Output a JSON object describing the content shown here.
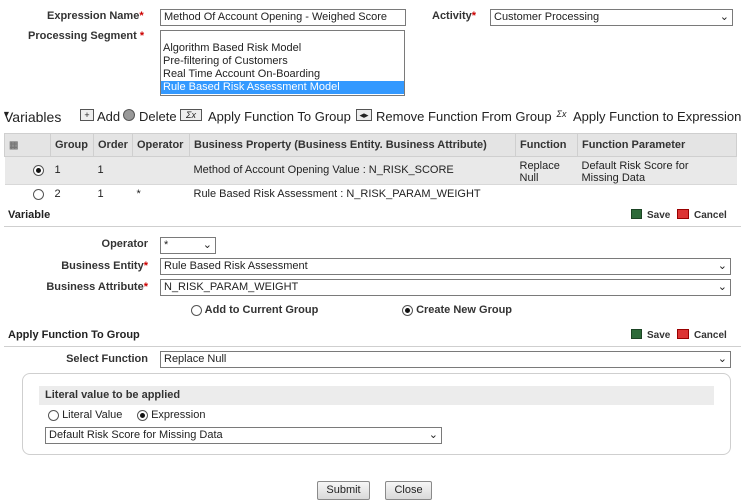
{
  "form": {
    "expression_name_label": "Expression Name",
    "expression_name_value": "Method Of Account Opening - Weighed Score",
    "activity_label": "Activity",
    "activity_value": "Customer Processing",
    "processing_segment_label": "Processing Segment",
    "required_mark": "*",
    "segments": [
      "Algorithm Based Risk Model",
      "Pre-filtering of Customers",
      "Real Time Account On-Boarding",
      "Rule Based Risk Assessment Model"
    ],
    "selected_segment_index": 3
  },
  "toolbar": {
    "variables_label": "Variables",
    "add_label": "Add",
    "delete_label": "Delete",
    "apply_group_label": "Apply Function To Group",
    "remove_function_label": "Remove Function From Group",
    "apply_expression_label": "Apply Function to Expression"
  },
  "grid": {
    "headers": [
      "Group",
      "Order",
      "Operator",
      "Business Property (Business Entity. Business Attribute)",
      "Function",
      "Function Parameter"
    ],
    "rows": [
      {
        "group": "1",
        "order": "1",
        "operator": "",
        "property": "Method of Account Opening Value : N_RISK_SCORE",
        "function_l1": "Replace",
        "function_l2": "Null",
        "param_l1": "Default Risk Score for",
        "param_l2": "Missing Data",
        "selected": true
      },
      {
        "group": "2",
        "order": "1",
        "operator": "*",
        "property": "Rule Based Risk Assessment  : N_RISK_PARAM_WEIGHT",
        "function_l1": "",
        "function_l2": "",
        "param_l1": "",
        "param_l2": "",
        "selected": false
      }
    ]
  },
  "variable": {
    "title": "Variable",
    "save_label": "Save",
    "cancel_label": "Cancel",
    "operator_label": "Operator",
    "operator_value": "*",
    "entity_label": "Business Entity",
    "entity_value": "Rule Based Risk Assessment",
    "attribute_label": "Business Attribute",
    "attribute_value": "N_RISK_PARAM_WEIGHT",
    "add_current_group_label": "Add to Current Group",
    "create_new_group_label": "Create New Group"
  },
  "apply_function": {
    "title": "Apply Function To Group",
    "save_label": "Save",
    "cancel_label": "Cancel",
    "select_function_label": "Select Function",
    "select_function_value": "Replace Null",
    "literal_title": "Literal value to be applied",
    "literal_value_label": "Literal Value",
    "expression_label": "Expression",
    "expression_value": "Default Risk Score for Missing Data"
  },
  "buttons": {
    "submit": "Submit",
    "close": "Close"
  },
  "icons": {
    "chevron": "⌵"
  }
}
